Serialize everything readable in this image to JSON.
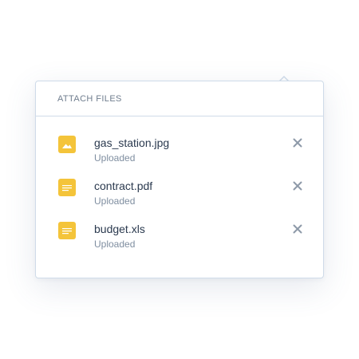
{
  "popover": {
    "title": "ATTACH FILES"
  },
  "files": [
    {
      "name": "gas_station.jpg",
      "status": "Uploaded",
      "icon": "image-file-icon"
    },
    {
      "name": "contract.pdf",
      "status": "Uploaded",
      "icon": "document-file-icon"
    },
    {
      "name": "budget.xls",
      "status": "Uploaded",
      "icon": "document-file-icon"
    }
  ],
  "colors": {
    "file_icon": "#f4c43a",
    "border": "#cfdbe9",
    "text_primary": "#2b3a4f",
    "text_secondary": "#7f8ea0",
    "remove_icon": "#8d99a8"
  }
}
